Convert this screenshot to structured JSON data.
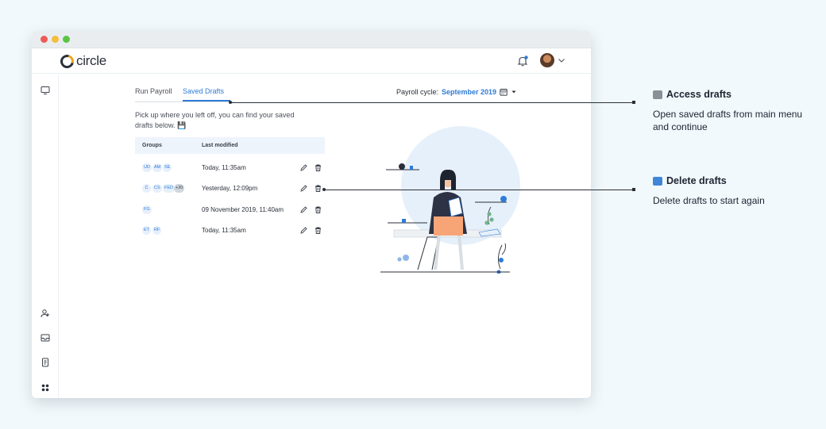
{
  "app": {
    "brand": "circle"
  },
  "tabs": [
    {
      "label": "Run Payroll"
    },
    {
      "label": "Saved Drafts"
    }
  ],
  "payroll_cycle": {
    "label": "Payroll cycle:",
    "value": "September 2019"
  },
  "intro": {
    "text": "Pick up where you left off, you can find your saved drafts below. 💾"
  },
  "table": {
    "headers": {
      "groups": "Groups",
      "modified": "Last modified"
    },
    "rows": [
      {
        "chips": [
          "UD",
          "AM",
          "SE"
        ],
        "modified": "Today, 11:35am"
      },
      {
        "chips": [
          "C",
          "CS",
          "FED",
          "+20"
        ],
        "modified": "Yesterday, 12:09pm"
      },
      {
        "chips": [
          "FG"
        ],
        "modified": "09 November 2019, 11:40am"
      },
      {
        "chips": [
          "ET",
          "RF"
        ],
        "modified": "Today, 11:35am"
      }
    ]
  },
  "annotations": [
    {
      "title": "Access drafts",
      "icon": "folder-icon",
      "desc": "Open saved drafts from main menu and continue"
    },
    {
      "title": "Delete drafts",
      "icon": "number-one-icon",
      "desc": "Delete drafts to start again"
    }
  ],
  "colors": {
    "accent": "#2f7bd6",
    "brand_orange": "#f3a21b",
    "illustration_box": "#f7a477"
  }
}
